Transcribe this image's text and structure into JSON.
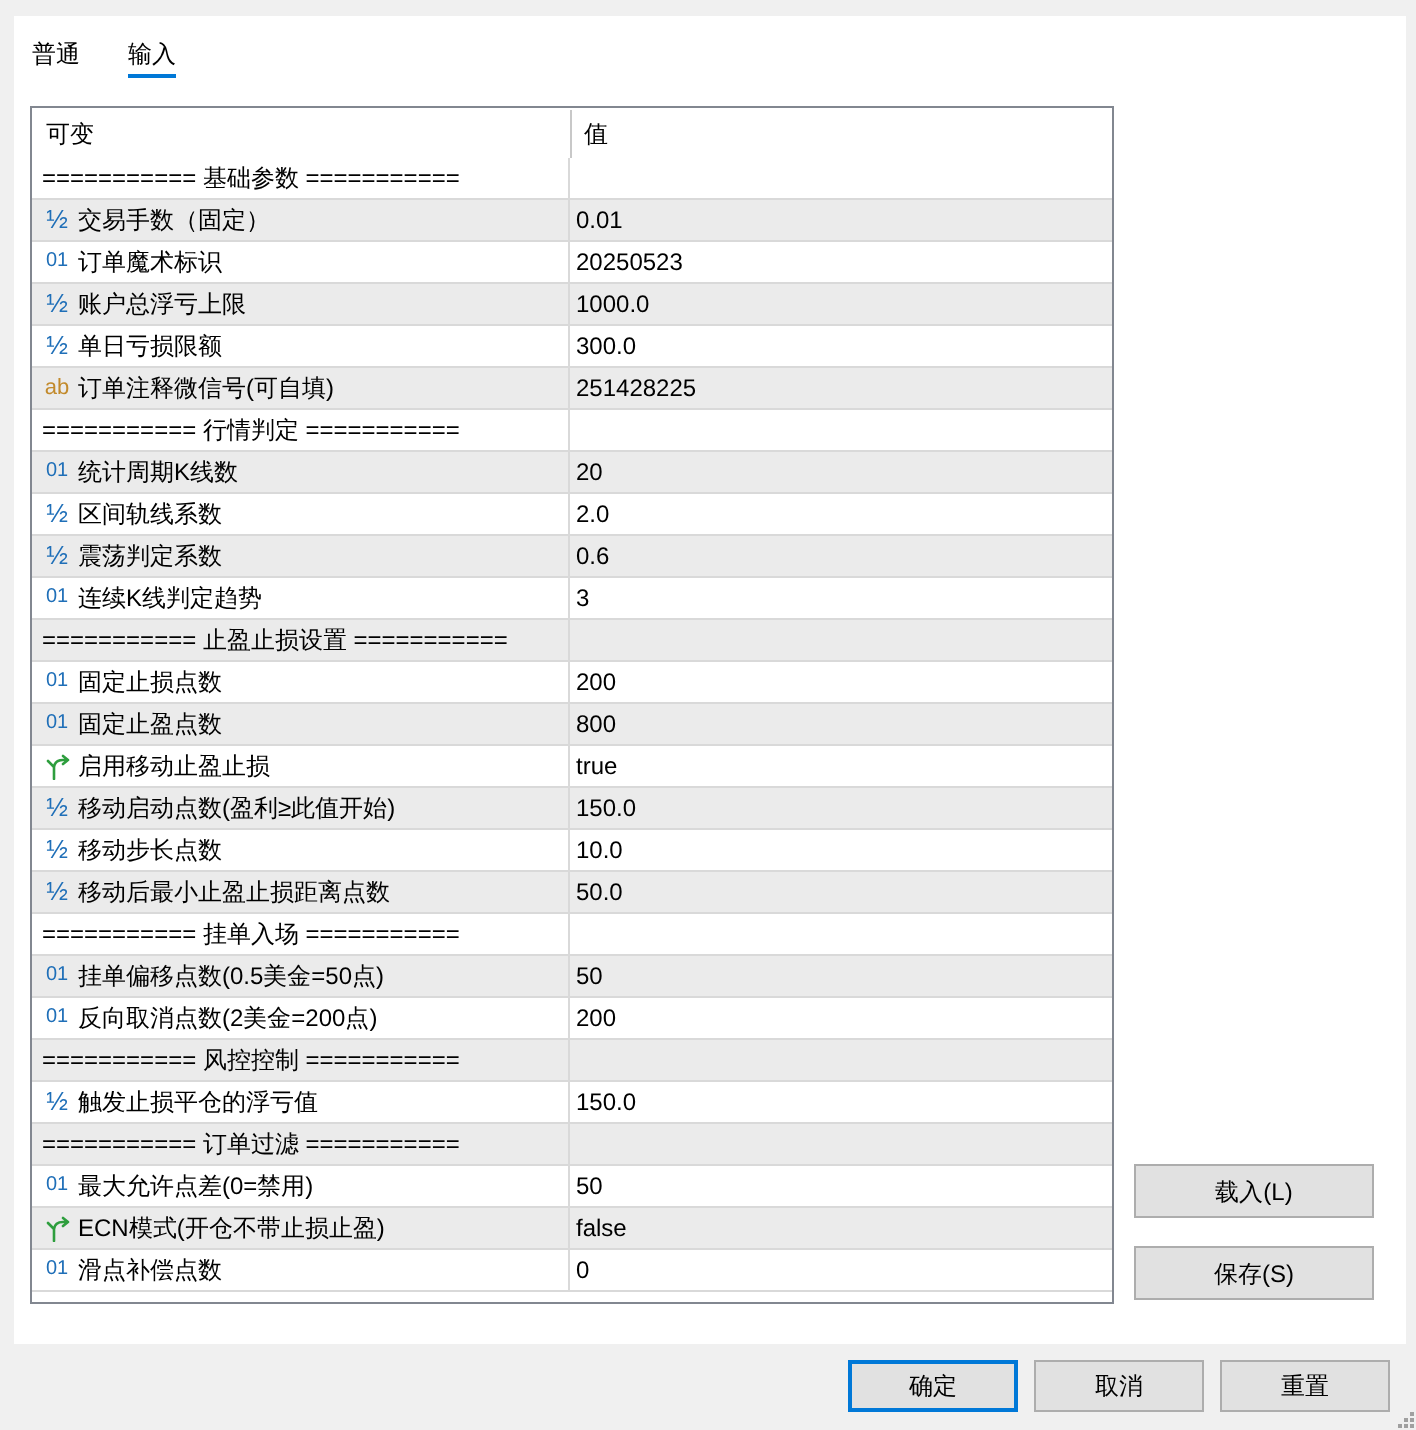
{
  "tabs": [
    {
      "label": "普通",
      "selected": false
    },
    {
      "label": "输入",
      "selected": true
    }
  ],
  "table": {
    "columns": [
      "可变",
      "值"
    ],
    "rows": [
      {
        "kind": "group",
        "name": "=========== 基础参数 ==========="
      },
      {
        "kind": "double",
        "icon": "½",
        "name": "交易手数（固定）",
        "value": "0.01"
      },
      {
        "kind": "integer",
        "icon": "01",
        "name": "订单魔术标识",
        "value": "20250523"
      },
      {
        "kind": "double",
        "icon": "½",
        "name": "账户总浮亏上限",
        "value": "1000.0"
      },
      {
        "kind": "double",
        "icon": "½",
        "name": "单日亏损限额",
        "value": "300.0"
      },
      {
        "kind": "string",
        "icon": "ab",
        "name": "订单注释微信号(可自填)",
        "value": "251428225"
      },
      {
        "kind": "group",
        "name": "=========== 行情判定 ==========="
      },
      {
        "kind": "integer",
        "icon": "01",
        "name": "统计周期K线数",
        "value": "20"
      },
      {
        "kind": "double",
        "icon": "½",
        "name": "区间轨线系数",
        "value": "2.0"
      },
      {
        "kind": "double",
        "icon": "½",
        "name": "震荡判定系数",
        "value": "0.6"
      },
      {
        "kind": "integer",
        "icon": "01",
        "name": "连续K线判定趋势",
        "value": "3"
      },
      {
        "kind": "group",
        "name": "=========== 止盈止损设置 ==========="
      },
      {
        "kind": "integer",
        "icon": "01",
        "name": "固定止损点数",
        "value": "200"
      },
      {
        "kind": "integer",
        "icon": "01",
        "name": "固定止盈点数",
        "value": "800"
      },
      {
        "kind": "bool",
        "name": "启用移动止盈止损",
        "value": "true"
      },
      {
        "kind": "double",
        "icon": "½",
        "name": "移动启动点数(盈利≥此值开始)",
        "value": "150.0"
      },
      {
        "kind": "double",
        "icon": "½",
        "name": "移动步长点数",
        "value": "10.0"
      },
      {
        "kind": "double",
        "icon": "½",
        "name": "移动后最小止盈止损距离点数",
        "value": "50.0"
      },
      {
        "kind": "group",
        "name": "=========== 挂单入场 ==========="
      },
      {
        "kind": "integer",
        "icon": "01",
        "name": "挂单偏移点数(0.5美金=50点)",
        "value": "50"
      },
      {
        "kind": "integer",
        "icon": "01",
        "name": "反向取消点数(2美金=200点)",
        "value": "200"
      },
      {
        "kind": "group",
        "name": "=========== 风控控制 ==========="
      },
      {
        "kind": "double",
        "icon": "½",
        "name": "触发止损平仓的浮亏值",
        "value": "150.0"
      },
      {
        "kind": "group",
        "name": "=========== 订单过滤 ==========="
      },
      {
        "kind": "integer",
        "icon": "01",
        "name": "最大允许点差(0=禁用)",
        "value": "50"
      },
      {
        "kind": "bool",
        "name": "ECN模式(开仓不带止损止盈)",
        "value": "false"
      },
      {
        "kind": "integer",
        "icon": "01",
        "name": "滑点补偿点数",
        "value": "0"
      }
    ]
  },
  "side_buttons": [
    "载入(L)",
    "保存(S)"
  ],
  "buttons": [
    {
      "label": "确定",
      "default": true
    },
    {
      "label": "取消",
      "default": false
    },
    {
      "label": "重置",
      "default": false
    }
  ]
}
